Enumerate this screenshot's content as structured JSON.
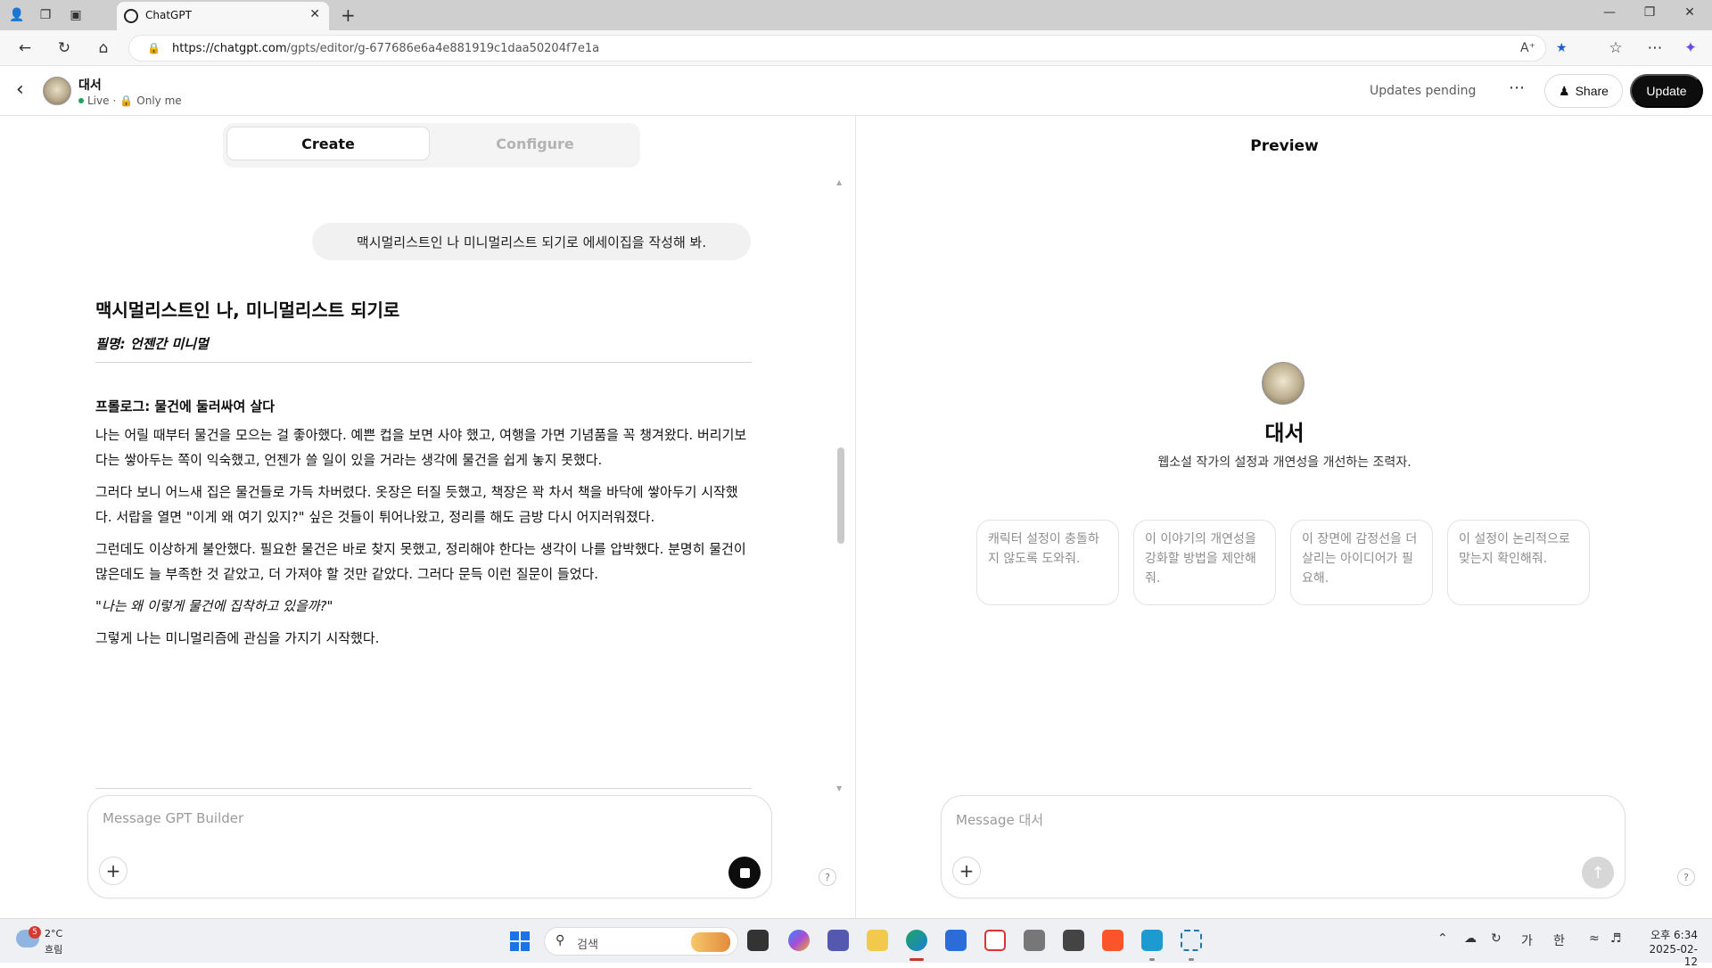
{
  "browser": {
    "tab_title": "ChatGPT",
    "url_host": "https://chatgpt.com",
    "url_path": "/gpts/editor/g-677686e6a4e881919c1daa50204f7e1a"
  },
  "header": {
    "gpt_name": "대서",
    "status_live": "Live",
    "status_sep": "·",
    "status_visibility": "Only me",
    "updates_pending": "Updates pending",
    "share_label": "Share",
    "update_label": "Update"
  },
  "builder": {
    "tab_create": "Create",
    "tab_configure": "Configure",
    "user_message": "맥시멀리스트인 나 미니멀리스트 되기로 에세이집을 작성해 봐.",
    "essay": {
      "title": "맥시멀리스트인 나, 미니멀리스트 되기로",
      "pen_name": "필명: 언젠간 미니멀",
      "section_heading": "프롤로그: 물건에 둘러싸여 살다",
      "paragraphs": [
        "나는 어릴 때부터 물건을 모으는 걸 좋아했다. 예쁜 컵을 보면 사야 했고, 여행을 가면 기념품을 꼭 챙겨왔다. 버리기보다는 쌓아두는 쪽이 익숙했고, 언젠가 쓸 일이 있을 거라는 생각에 물건을 쉽게 놓지 못했다.",
        "그러다 보니 어느새 집은 물건들로 가득 차버렸다. 옷장은 터질 듯했고, 책장은 꽉 차서 책을 바닥에 쌓아두기 시작했다. 서랍을 열면 \"이게 왜 여기 있지?\" 싶은 것들이 튀어나왔고, 정리를 해도 금방 다시 어지러워졌다.",
        "그런데도 이상하게 불안했다. 필요한 물건은 바로 찾지 못했고, 정리해야 한다는 생각이 나를 압박했다. 분명히 물건이 많은데도 늘 부족한 것 같았고, 더 가져야 할 것만 같았다. 그러다 문득 이런 질문이 들었다."
      ],
      "quote": "\"나는 왜 이렇게 물건에 집착하고 있을까?\"",
      "closing": "그렇게 나는 미니멀리즘에 관심을 가지기 시작했다."
    },
    "composer_placeholder": "Message GPT Builder"
  },
  "preview": {
    "title": "Preview",
    "gpt_name": "대서",
    "description": "웹소설 작가의 설정과 개연성을 개선하는 조력자.",
    "starters": [
      "캐릭터 설정이 충돌하지 않도록 도와줘.",
      "이 이야기의 개연성을 강화할 방법을 제안해줘.",
      "이 장면에 감정선을 더 살리는 아이디어가 필요해.",
      "이 설정이 논리적으로 맞는지 확인해줘."
    ],
    "composer_placeholder": "Message 대서"
  },
  "taskbar": {
    "weather_badge": "5",
    "weather_temp": "2°C",
    "weather_cond": "흐림",
    "search_text": "검색",
    "ime_1": "가",
    "ime_2": "한",
    "time": "오후 6:34",
    "date": "2025-02-12"
  },
  "icons": {
    "help": "?"
  }
}
